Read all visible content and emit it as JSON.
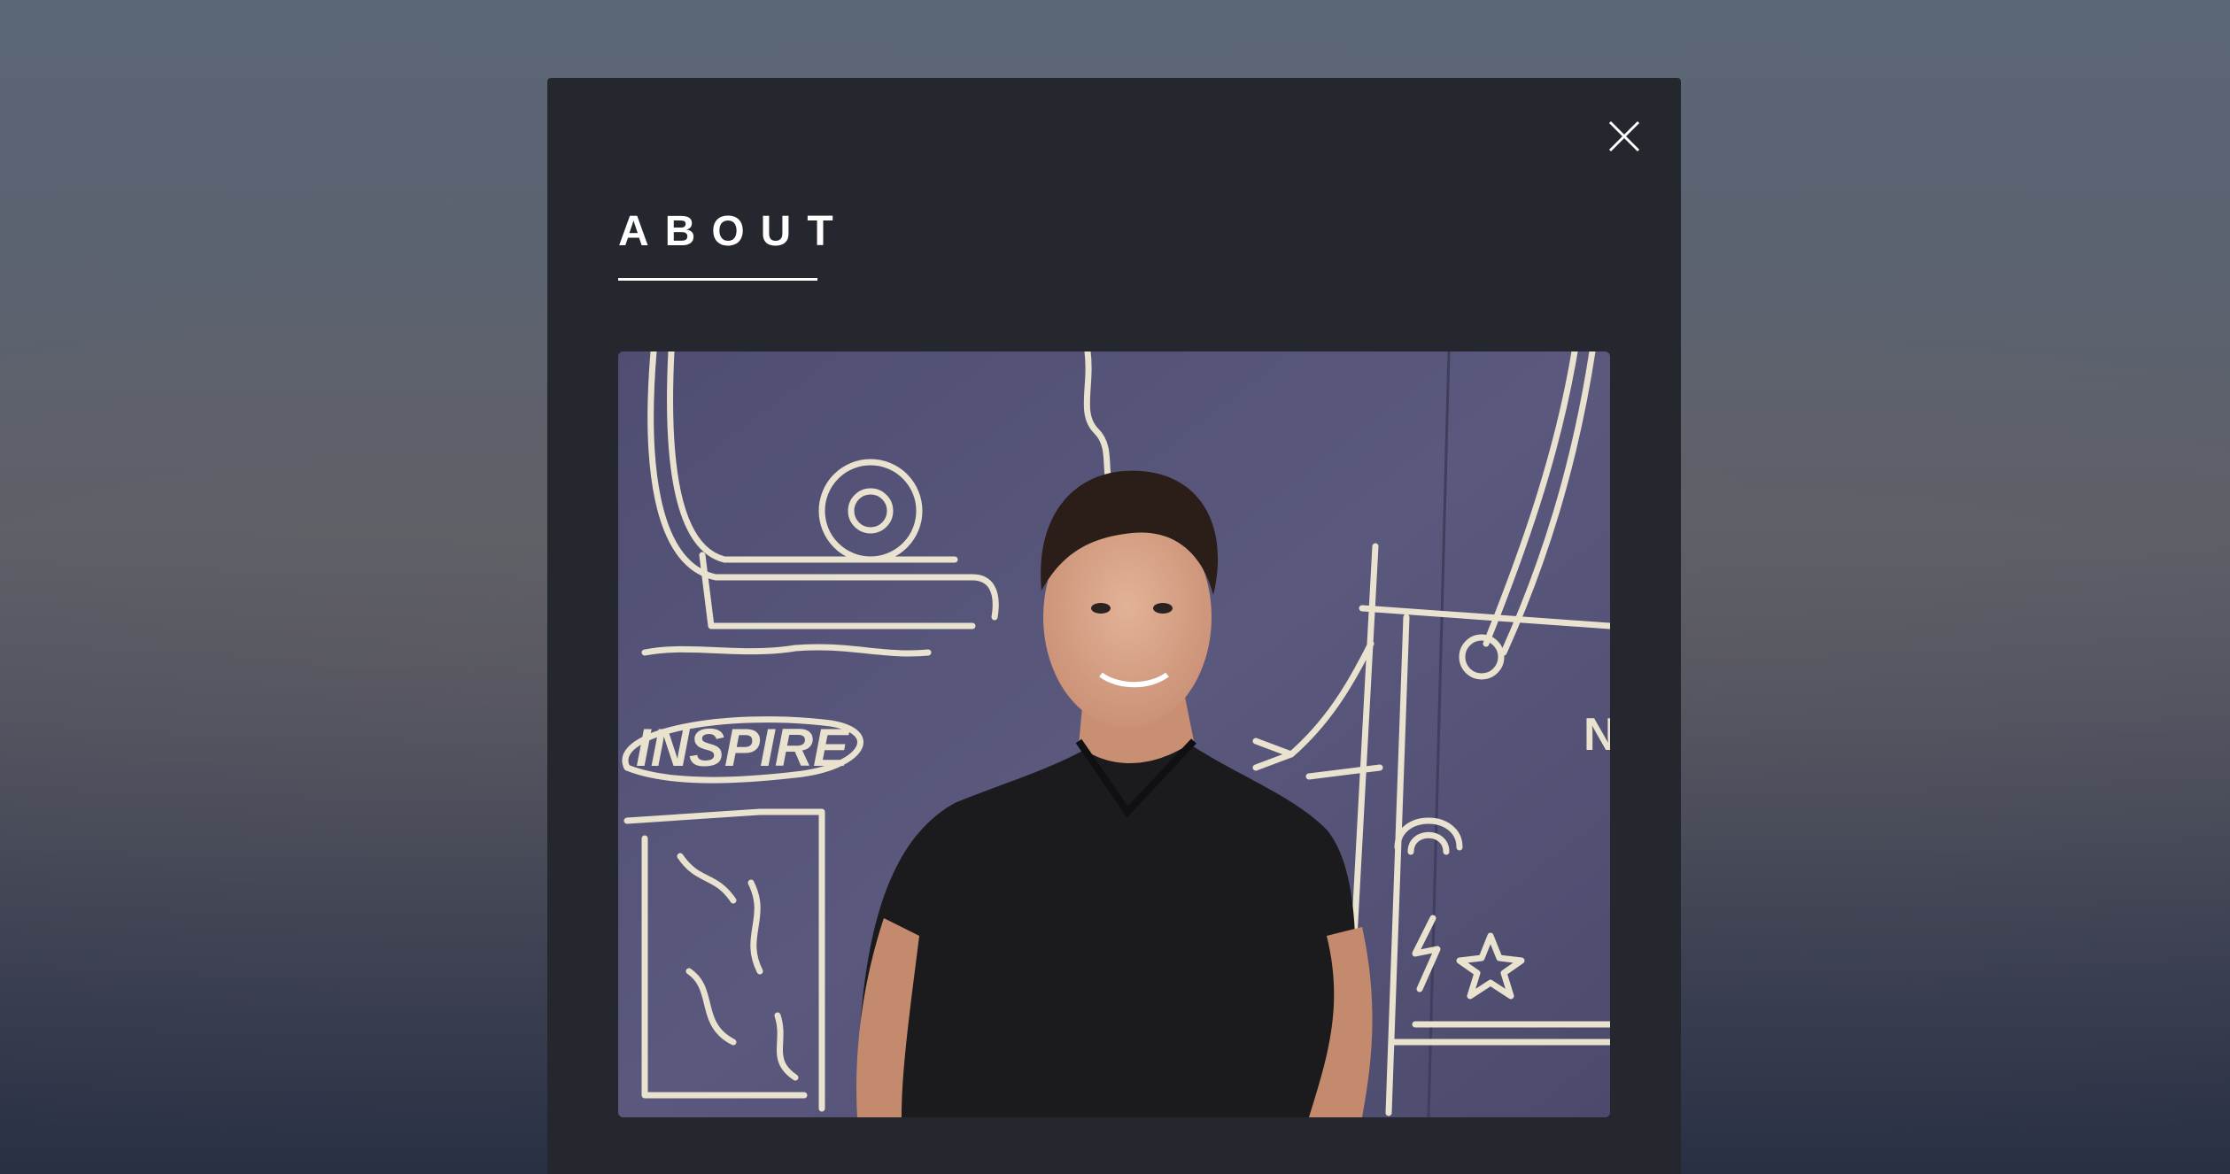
{
  "modal": {
    "title": "ABOUT",
    "close_icon": "close-icon",
    "photo": {
      "icon": "portrait-photo",
      "mural_text": "INSPIRE"
    }
  },
  "colors": {
    "modal_background": "#24272d",
    "title_color": "#ffffff",
    "mural_wall": "#56557a",
    "mural_chalk": "#e8e2cf",
    "shirt": "#1b1b1d",
    "skin": "#d9a58a"
  }
}
